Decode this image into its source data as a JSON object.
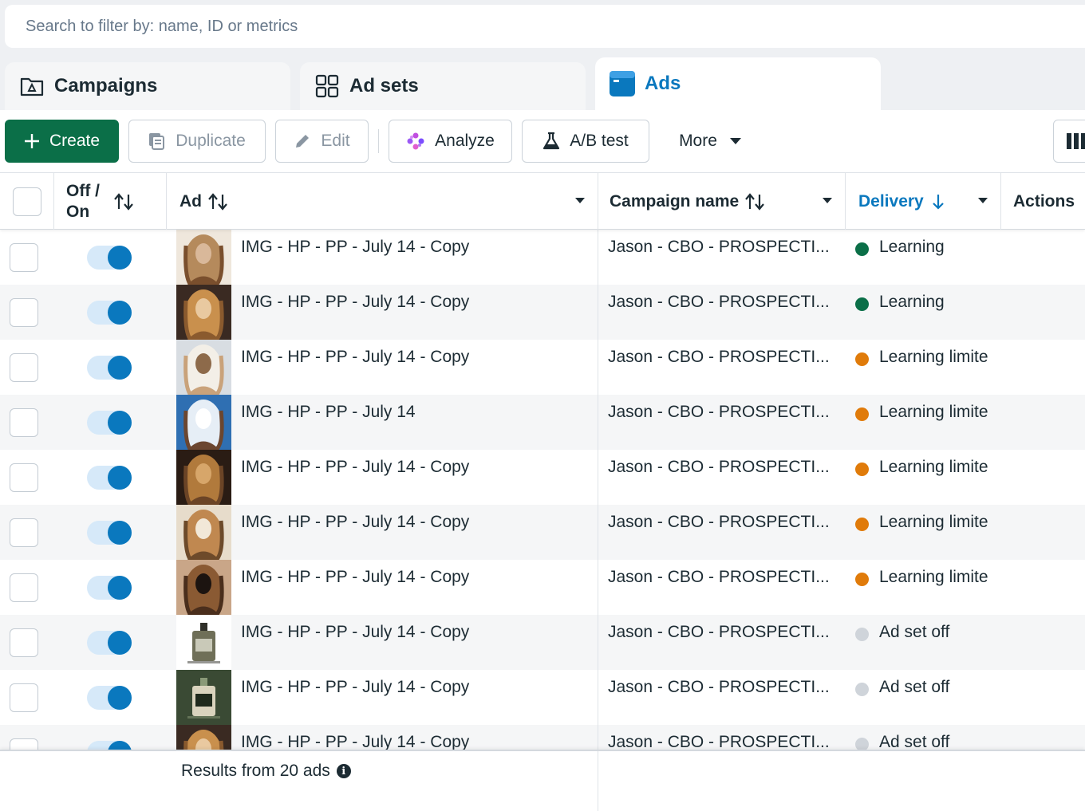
{
  "search": {
    "placeholder": "Search to filter by: name, ID or metrics"
  },
  "tabs": [
    {
      "label": "Campaigns",
      "icon": "folder-icon"
    },
    {
      "label": "Ad sets",
      "icon": "grid-icon"
    },
    {
      "label": "Ads",
      "icon": "ad-window-icon",
      "active": true
    }
  ],
  "toolbar": {
    "create_label": "Create",
    "duplicate_label": "Duplicate",
    "edit_label": "Edit",
    "analyze_label": "Analyze",
    "abtest_label": "A/B test",
    "more_label": "More"
  },
  "table": {
    "headers": {
      "off_on_line1": "Off /",
      "off_on_line2": "On",
      "ad": "Ad",
      "campaign": "Campaign name",
      "delivery": "Delivery",
      "actions": "Actions"
    },
    "rows": [
      {
        "ad": "IMG - HP - PP - July 14 - Copy",
        "campaign": "Jason - CBO - PROSPECTI...",
        "delivery": "Learning",
        "status": "green",
        "thumb": "portrait-a"
      },
      {
        "ad": "IMG - HP - PP - July 14 - Copy",
        "campaign": "Jason - CBO - PROSPECTI...",
        "delivery": "Learning",
        "status": "green",
        "thumb": "portrait-b"
      },
      {
        "ad": "IMG - HP - PP - July 14 - Copy",
        "campaign": "Jason - CBO - PROSPECTI...",
        "delivery": "Learning limite",
        "status": "orange",
        "thumb": "portrait-c"
      },
      {
        "ad": "IMG - HP - PP - July 14",
        "campaign": "Jason - CBO - PROSPECTI...",
        "delivery": "Learning limite",
        "status": "orange",
        "thumb": "portrait-d"
      },
      {
        "ad": "IMG - HP - PP - July 14 - Copy",
        "campaign": "Jason - CBO - PROSPECTI...",
        "delivery": "Learning limite",
        "status": "orange",
        "thumb": "portrait-e"
      },
      {
        "ad": "IMG - HP - PP - July 14 - Copy",
        "campaign": "Jason - CBO - PROSPECTI...",
        "delivery": "Learning limite",
        "status": "orange",
        "thumb": "portrait-f"
      },
      {
        "ad": "IMG - HP - PP - July 14 - Copy",
        "campaign": "Jason - CBO - PROSPECTI...",
        "delivery": "Learning limite",
        "status": "orange",
        "thumb": "portrait-g"
      },
      {
        "ad": "IMG - HP - PP - July 14 - Copy",
        "campaign": "Jason - CBO - PROSPECTI...",
        "delivery": "Ad set off",
        "status": "grey",
        "thumb": "bottle-a"
      },
      {
        "ad": "IMG - HP - PP - July 14 - Copy",
        "campaign": "Jason - CBO - PROSPECTI...",
        "delivery": "Ad set off",
        "status": "grey",
        "thumb": "bottle-b"
      },
      {
        "ad": "IMG - HP - PP - July 14 - Copy",
        "campaign": "Jason - CBO - PROSPECTI...",
        "delivery": "Ad set off",
        "status": "grey",
        "thumb": "portrait-b"
      }
    ]
  },
  "footer": {
    "results_label": "Results from 20 ads"
  },
  "colors": {
    "green": "#0b6f48",
    "orange": "#e07b0a",
    "grey": "#cfd4da",
    "accent": "#0a78be"
  }
}
